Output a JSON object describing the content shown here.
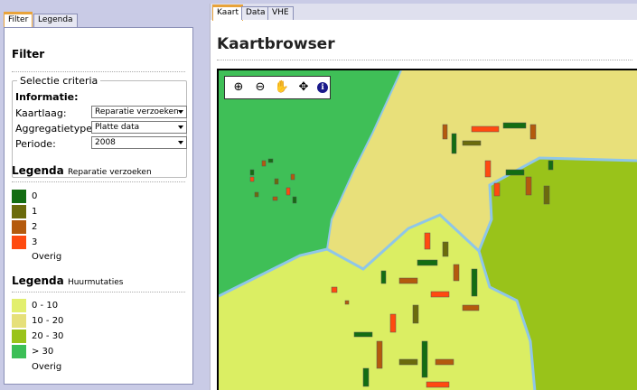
{
  "left_tabs": [
    "Filter",
    "Legenda"
  ],
  "filter": {
    "title": "Filter",
    "fieldset_legend": "Selectie criteria",
    "info_heading": "Informatie:",
    "rows": [
      {
        "label": "Kaartlaag:",
        "value": "Reparatie verzoeken"
      },
      {
        "label": "Aggregatietype:",
        "value": "Platte data"
      },
      {
        "label": "Periode:",
        "value": "2008"
      }
    ]
  },
  "legend1": {
    "title": "Legenda",
    "subtitle": "Reparatie verzoeken",
    "items": [
      {
        "label": "0",
        "color": "#136d12"
      },
      {
        "label": "1",
        "color": "#6b6b0c"
      },
      {
        "label": "2",
        "color": "#b45a0d"
      },
      {
        "label": "3",
        "color": "#ff4a10"
      },
      {
        "label": "Overig",
        "color": ""
      }
    ]
  },
  "legend2": {
    "title": "Legenda",
    "subtitle": "Huurmutaties",
    "items": [
      {
        "label": "0 - 10",
        "color": "#e2ef6e"
      },
      {
        "label": "10 - 20",
        "color": "#e6e07a"
      },
      {
        "label": "20 - 30",
        "color": "#99c31a"
      },
      {
        "label": "> 30",
        "color": "#3cbf57"
      },
      {
        "label": "Overig",
        "color": ""
      }
    ]
  },
  "right_tabs": [
    "Kaart",
    "Data",
    "VHE"
  ],
  "page_title": "Kaartbrowser",
  "map_tools": [
    {
      "icon": "zoom-in-icon",
      "glyph": "⊕"
    },
    {
      "icon": "zoom-out-icon",
      "glyph": "⊖"
    },
    {
      "icon": "pan-hand-icon",
      "glyph": "✋"
    },
    {
      "icon": "full-extent-icon",
      "glyph": "✥"
    },
    {
      "icon": "info-icon",
      "glyph": "ℹ"
    }
  ],
  "colors": {
    "accent": "#e8a33a",
    "region_lightgreen": "#dbee63",
    "region_yellow": "#e8e07a",
    "region_green": "#99c31a",
    "region_darkgreen": "#3fbf57",
    "boundary": "#8fc6e8"
  }
}
